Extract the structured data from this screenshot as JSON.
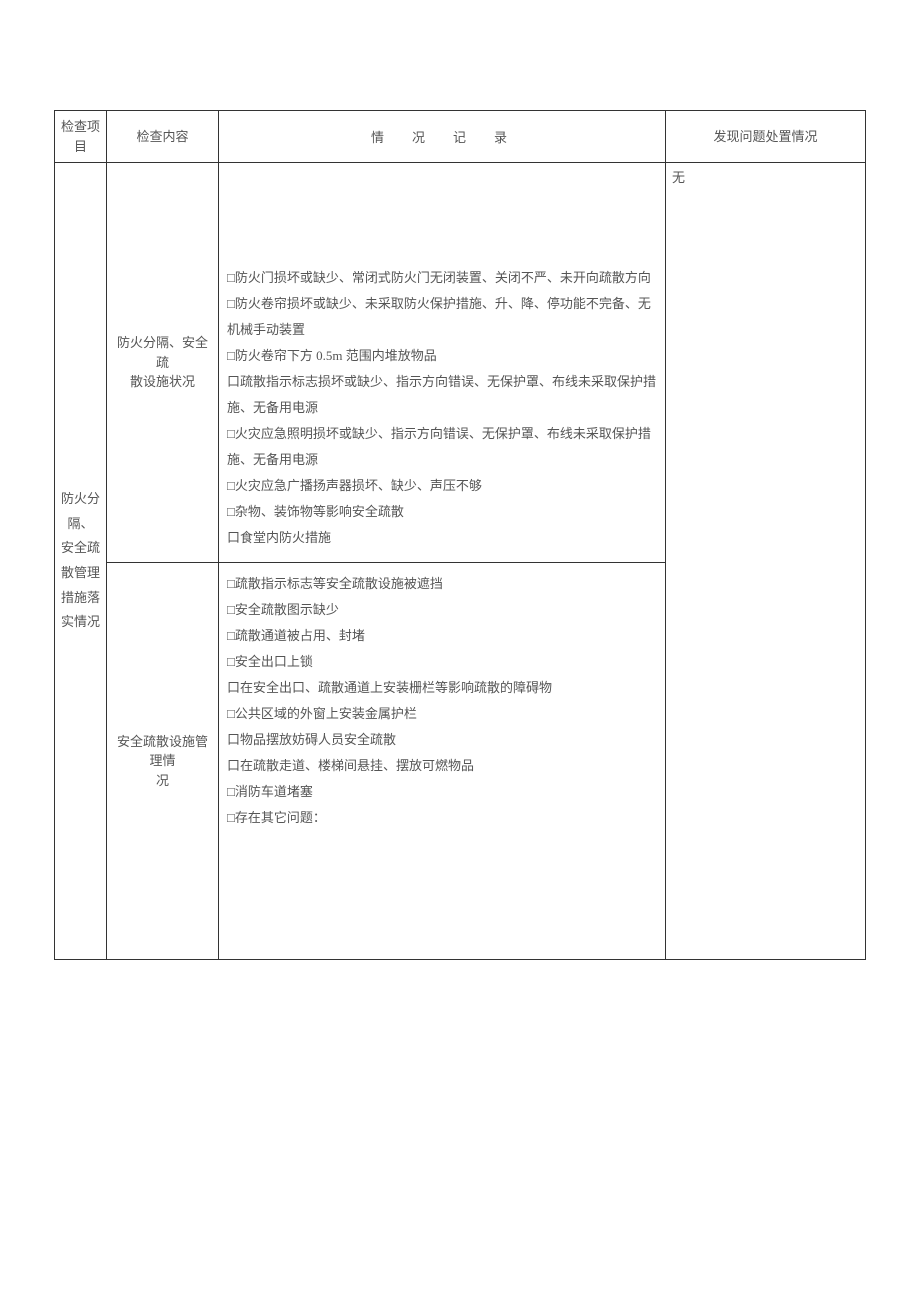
{
  "headers": {
    "col1_line1": "检查项",
    "col1_line2": "目",
    "col2": "检查内容",
    "col3": "情况记录",
    "col4": "发现问题处置情况"
  },
  "category": {
    "l1": "防火分",
    "l2": "隔、",
    "l3": "安全疏",
    "l4": "散管理",
    "l5": "措施落",
    "l6": "实情况"
  },
  "rowA": {
    "content_l1": "防火分隔、安全疏",
    "content_l2": "散设施状况",
    "items": {
      "i1": "□防火门损坏或缺少、常闭式防火门无闭装置、关闭不严、未开向疏散方向",
      "i2": "□防火卷帘损坏或缺少、未采取防火保护措施、升、降、停功能不完备、无机械手动装置",
      "i3": "□防火卷帘下方 0.5m 范围内堆放物品",
      "i4": "口疏散指示标志损坏或缺少、指示方向错误、无保护罩、布线未采取保护措施、无备用电源",
      "i5": "□火灾应急照明损坏或缺少、指示方向错误、无保护罩、布线未采取保护措施、无备用电源",
      "i6": "□火灾应急广播扬声器损坏、缺少、声压不够",
      "i7": "□杂物、装饰物等影响安全疏散",
      "i8": "口食堂内防火措施"
    }
  },
  "rowB": {
    "content_l1": "安全疏散设施管理情",
    "content_l2": "况",
    "items": {
      "i1": "□疏散指示标志等安全疏散设施被遮挡",
      "i2": "□安全疏散图示缺少",
      "i3": "□疏散通道被占用、封堵",
      "i4": "□安全出口上锁",
      "i5": "口在安全出口、疏散通道上安装栅栏等影响疏散的障碍物",
      "i6": "□公共区域的外窗上安装金属护栏",
      "i7": "口物品摆放妨碍人员安全疏散",
      "i8": "口在疏散走道、楼梯间悬挂、摆放可燃物品",
      "i9": "□消防车道堵塞",
      "i10": "□存在其它问题："
    }
  },
  "disposition": "无"
}
